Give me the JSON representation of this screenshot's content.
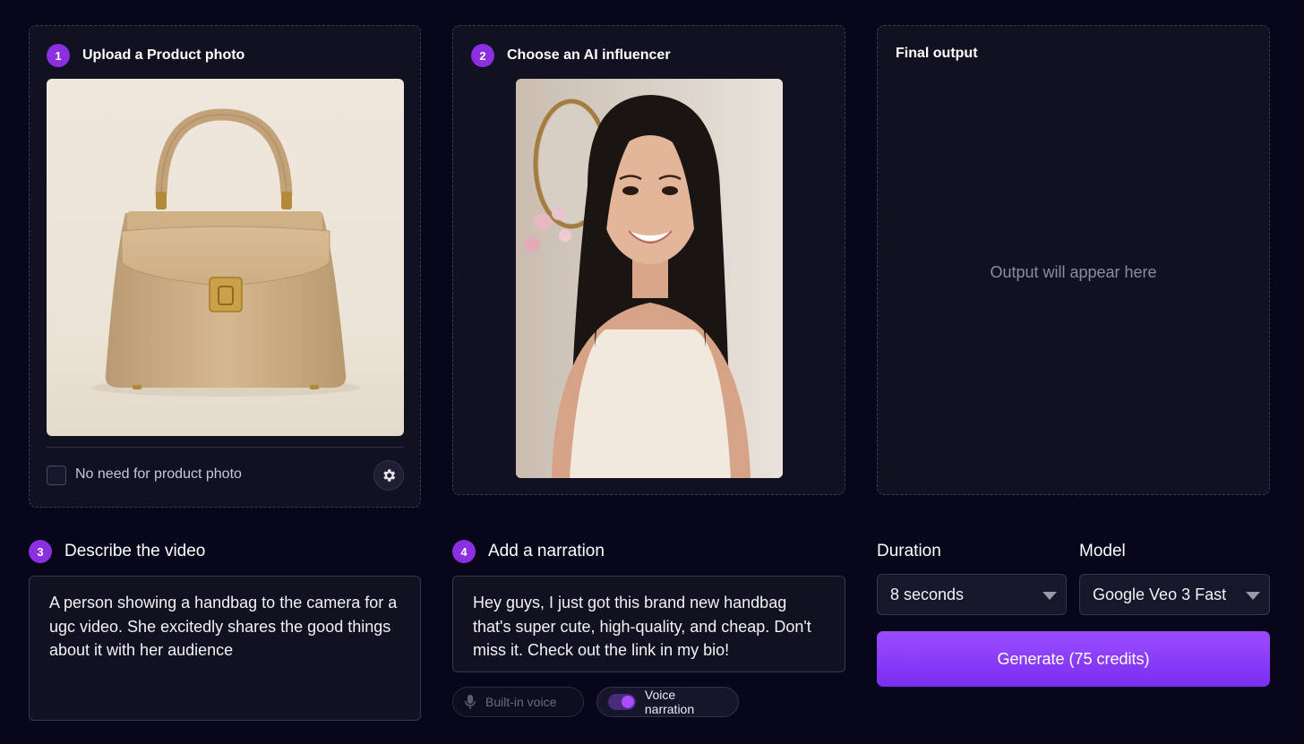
{
  "steps": {
    "product": {
      "number": "1",
      "title": "Upload a Product photo",
      "checkbox_label": "No need for product photo"
    },
    "influencer": {
      "number": "2",
      "title": "Choose an AI influencer"
    },
    "describe": {
      "number": "3",
      "title": "Describe the video",
      "text": "A person showing a handbag to the camera for a ugc video. She excitedly shares the good things about it with her audience"
    },
    "narration": {
      "number": "4",
      "title": "Add a narration",
      "text": "Hey guys, I just got this brand new handbag that's super cute, high-quality, and cheap. Don't miss it. Check out the link in my bio!"
    }
  },
  "output": {
    "title": "Final output",
    "placeholder": "Output will appear here"
  },
  "voice_options": {
    "builtin_label": "Built-in voice",
    "narration_label": "Voice narration",
    "narration_enabled": true
  },
  "settings": {
    "duration_label": "Duration",
    "duration_value": "8 seconds",
    "model_label": "Model",
    "model_value": "Google Veo 3 Fast"
  },
  "generate_label": "Generate (75 credits)",
  "icons": {
    "settings": "gear-icon",
    "builtin_voice": "microphone-icon",
    "dropdown": "chevron-down-icon"
  },
  "colors": {
    "accent": "#8b2fe0",
    "background": "#07061a",
    "card": "#121121",
    "button": "#8a3df8"
  }
}
